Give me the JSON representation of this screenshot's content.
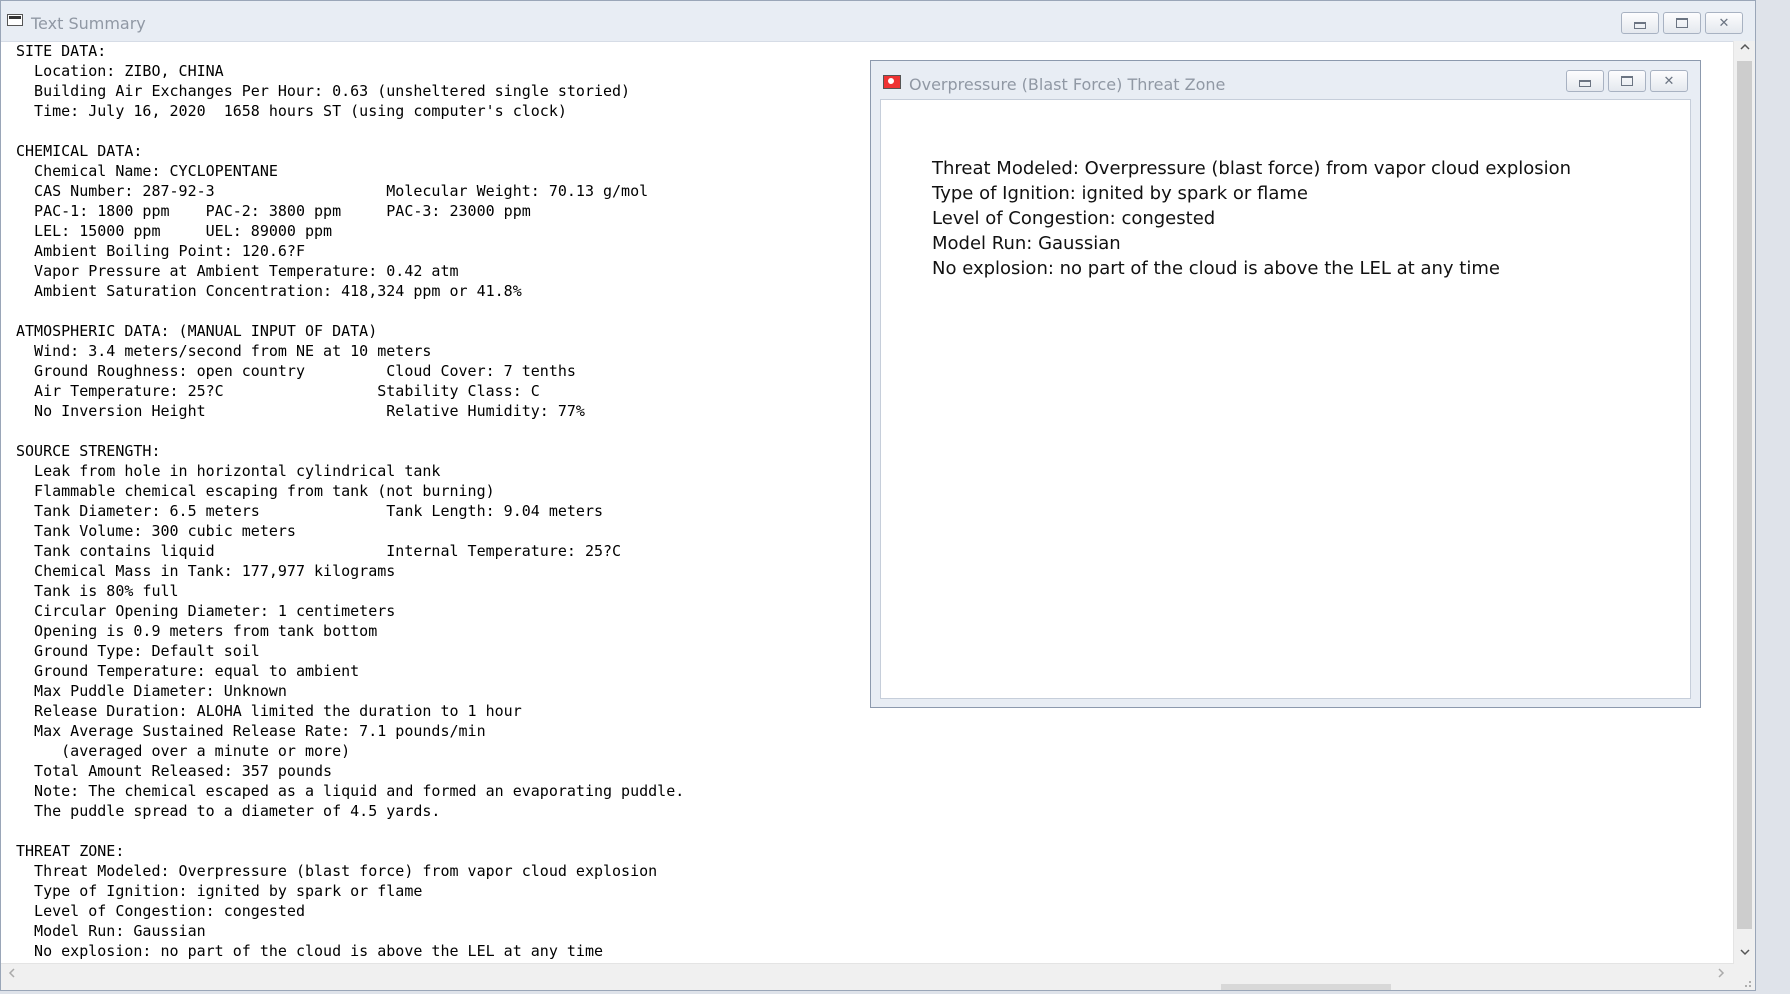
{
  "main_window": {
    "title": "Text Summary",
    "lines": [
      "SITE DATA:",
      "  Location: ZIBO, CHINA",
      "  Building Air Exchanges Per Hour: 0.63 (unsheltered single storied)",
      "  Time: July 16, 2020  1658 hours ST (using computer's clock)",
      "",
      "CHEMICAL DATA:",
      "  Chemical Name: CYCLOPENTANE",
      "  CAS Number: 287-92-3                   Molecular Weight: 70.13 g/mol",
      "  PAC-1: 1800 ppm    PAC-2: 3800 ppm     PAC-3: 23000 ppm",
      "  LEL: 15000 ppm     UEL: 89000 ppm",
      "  Ambient Boiling Point: 120.6?F",
      "  Vapor Pressure at Ambient Temperature: 0.42 atm",
      "  Ambient Saturation Concentration: 418,324 ppm or 41.8%",
      "",
      "ATMOSPHERIC DATA: (MANUAL INPUT OF DATA)",
      "  Wind: 3.4 meters/second from NE at 10 meters",
      "  Ground Roughness: open country         Cloud Cover: 7 tenths",
      "  Air Temperature: 25?C                 Stability Class: C",
      "  No Inversion Height                    Relative Humidity: 77%",
      "",
      "SOURCE STRENGTH:",
      "  Leak from hole in horizontal cylindrical tank",
      "  Flammable chemical escaping from tank (not burning)",
      "  Tank Diameter: 6.5 meters              Tank Length: 9.04 meters",
      "  Tank Volume: 300 cubic meters",
      "  Tank contains liquid                   Internal Temperature: 25?C",
      "  Chemical Mass in Tank: 177,977 kilograms",
      "  Tank is 80% full",
      "  Circular Opening Diameter: 1 centimeters",
      "  Opening is 0.9 meters from tank bottom",
      "  Ground Type: Default soil",
      "  Ground Temperature: equal to ambient",
      "  Max Puddle Diameter: Unknown",
      "  Release Duration: ALOHA limited the duration to 1 hour",
      "  Max Average Sustained Release Rate: 7.1 pounds/min",
      "     (averaged over a minute or more)",
      "  Total Amount Released: 357 pounds",
      "  Note: The chemical escaped as a liquid and formed an evaporating puddle.",
      "  The puddle spread to a diameter of 4.5 yards.",
      "",
      "THREAT ZONE:",
      "  Threat Modeled: Overpressure (blast force) from vapor cloud explosion",
      "  Type of Ignition: ignited by spark or flame",
      "  Level of Congestion: congested",
      "  Model Run: Gaussian",
      "  No explosion: no part of the cloud is above the LEL at any time"
    ]
  },
  "threat_window": {
    "title": "Overpressure (Blast Force) Threat Zone",
    "lines": [
      "Threat Modeled: Overpressure (blast force) from vapor cloud explosion",
      "Type of Ignition: ignited by spark or flame",
      "Level of Congestion: congested",
      "Model Run: Gaussian",
      "No explosion: no part of the cloud is above the LEL at any time"
    ]
  },
  "icons": {
    "minimize": "minimize-icon",
    "maximize": "maximize-icon",
    "close": "close-icon",
    "scroll_up": "▲",
    "scroll_down": "▼",
    "scroll_left": "<",
    "scroll_right": ">"
  }
}
